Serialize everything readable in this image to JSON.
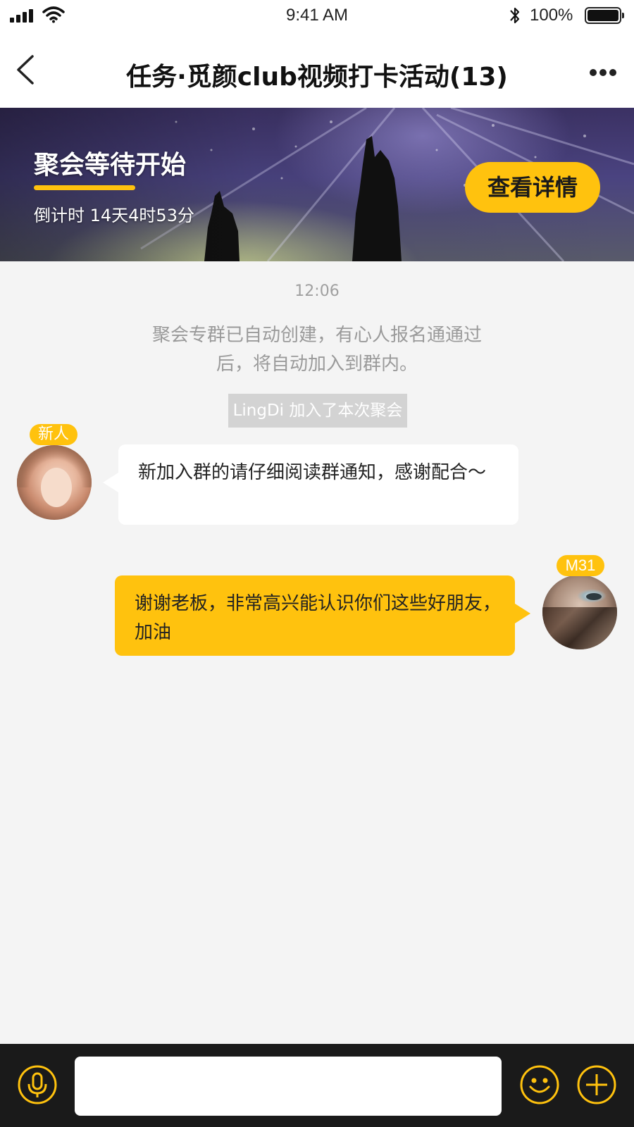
{
  "status_bar": {
    "time": "9:41 AM",
    "battery_percent": "100%",
    "icons": [
      "signal-icon",
      "wifi-icon",
      "bluetooth-icon",
      "battery-icon"
    ]
  },
  "nav": {
    "title": "任务·觅颜club视频打卡活动(13)",
    "icons": [
      "back-arrow-icon",
      "more-dots-icon"
    ]
  },
  "banner": {
    "title": "聚会等待开始",
    "countdown": "倒计时 14天4时53分",
    "details_button": "查看详情"
  },
  "chat": {
    "timestamp": "12:06",
    "system_notice": "聚会专群已自动创建，有心人报名通通过后，将自动加入到群内。",
    "join_notice": "LingDi 加入了本次聚会",
    "messages": [
      {
        "side": "left",
        "tag": "新人",
        "text": "新加入群的请仔细阅读群通知，感谢配合～"
      },
      {
        "side": "right",
        "tag": "M31",
        "text": "谢谢老板，非常高兴能认识你们这些好朋友，加油"
      }
    ]
  },
  "input_bar": {
    "message_value": "",
    "icons": [
      "microphone-icon",
      "emoji-icon",
      "plus-icon"
    ]
  },
  "colors": {
    "accent": "#ffc20e",
    "background": "#f4f4f4",
    "input_bar": "#1a1a1a"
  }
}
